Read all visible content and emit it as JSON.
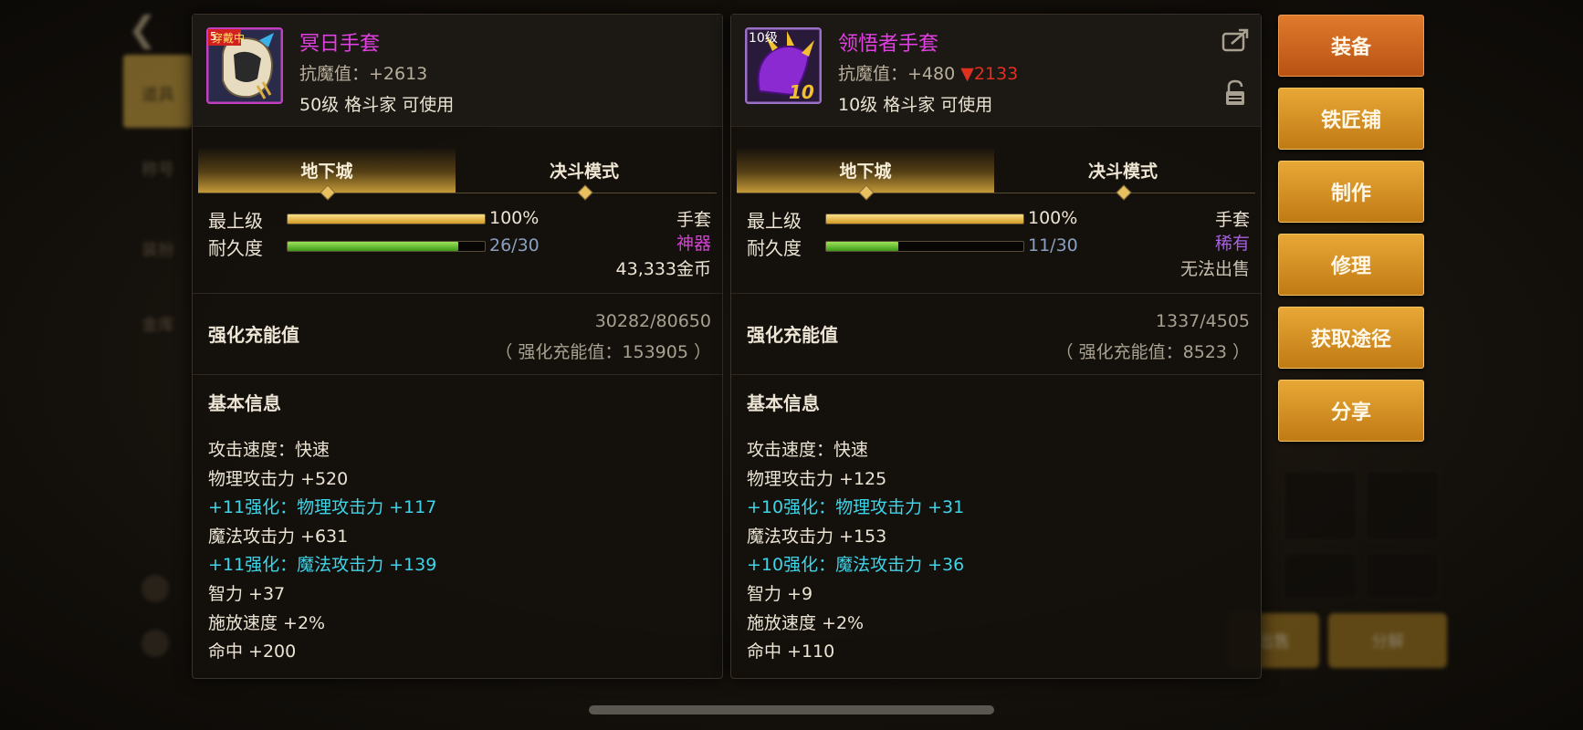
{
  "background": {
    "tabs": [
      "道具",
      "称号",
      "装扮",
      "金库"
    ],
    "buttons": [
      "出售",
      "分解"
    ]
  },
  "left_item": {
    "name": "冥日手套",
    "name_color": "#e040e0",
    "badge_level": "5",
    "badge_tag": "穿戴中",
    "defense": "抗魔值：+2613",
    "requirement": "50级 格斗家 可使用",
    "tabs": [
      "地下城",
      "决斗模式"
    ],
    "top_level_label": "最上级",
    "top_level_value": "100%",
    "top_level_fraction": 1.0,
    "durability_label": "耐久度",
    "durability_value": "26/30",
    "durability_fraction": 0.867,
    "slot_type": "手套",
    "rarity": "神器",
    "rarity_color": "#d840d8",
    "price": "43,333金币",
    "enhance_title": "强化充能值",
    "enhance_progress": "30282/80650",
    "enhance_total": "（ 强化充能值：153905 ）",
    "basic_info_title": "基本信息",
    "lines": [
      {
        "text": "攻击速度：快速",
        "cyan": false
      },
      {
        "text": "物理攻击力 +520",
        "cyan": false
      },
      {
        "text": "+11强化：物理攻击力 +117",
        "cyan": true
      },
      {
        "text": "魔法攻击力 +631",
        "cyan": false
      },
      {
        "text": "+11强化：魔法攻击力 +139",
        "cyan": true
      },
      {
        "text": "智力 +37",
        "cyan": false
      },
      {
        "text": "施放速度 +2%",
        "cyan": false
      },
      {
        "text": "命中 +200",
        "cyan": false
      }
    ]
  },
  "right_item": {
    "name": "领悟者手套",
    "name_color": "#e040e0",
    "badge_level": "10级",
    "badge_number": "10",
    "defense_prefix": "抗魔值：+480 ",
    "defense_diff": "▼2133",
    "requirement": "10级 格斗家 可使用",
    "tabs": [
      "地下城",
      "决斗模式"
    ],
    "top_level_label": "最上级",
    "top_level_value": "100%",
    "top_level_fraction": 1.0,
    "durability_label": "耐久度",
    "durability_value": "11/30",
    "durability_fraction": 0.367,
    "slot_type": "手套",
    "rarity": "稀有",
    "rarity_color": "#a860e0",
    "sell_status": "无法出售",
    "enhance_title": "强化充能值",
    "enhance_progress": "1337/4505",
    "enhance_total": "（ 强化充能值：8523 ）",
    "basic_info_title": "基本信息",
    "lines": [
      {
        "text": "攻击速度：快速",
        "cyan": false
      },
      {
        "text": "物理攻击力 +125",
        "cyan": false
      },
      {
        "text": "+10强化：物理攻击力 +31",
        "cyan": true
      },
      {
        "text": "魔法攻击力 +153",
        "cyan": false
      },
      {
        "text": "+10强化：魔法攻击力 +36",
        "cyan": true
      },
      {
        "text": "智力 +9",
        "cyan": false
      },
      {
        "text": "施放速度 +2%",
        "cyan": false
      },
      {
        "text": "命中 +110",
        "cyan": false
      }
    ]
  },
  "actions": [
    "装备",
    "铁匠铺",
    "制作",
    "修理",
    "获取途径",
    "分享"
  ]
}
